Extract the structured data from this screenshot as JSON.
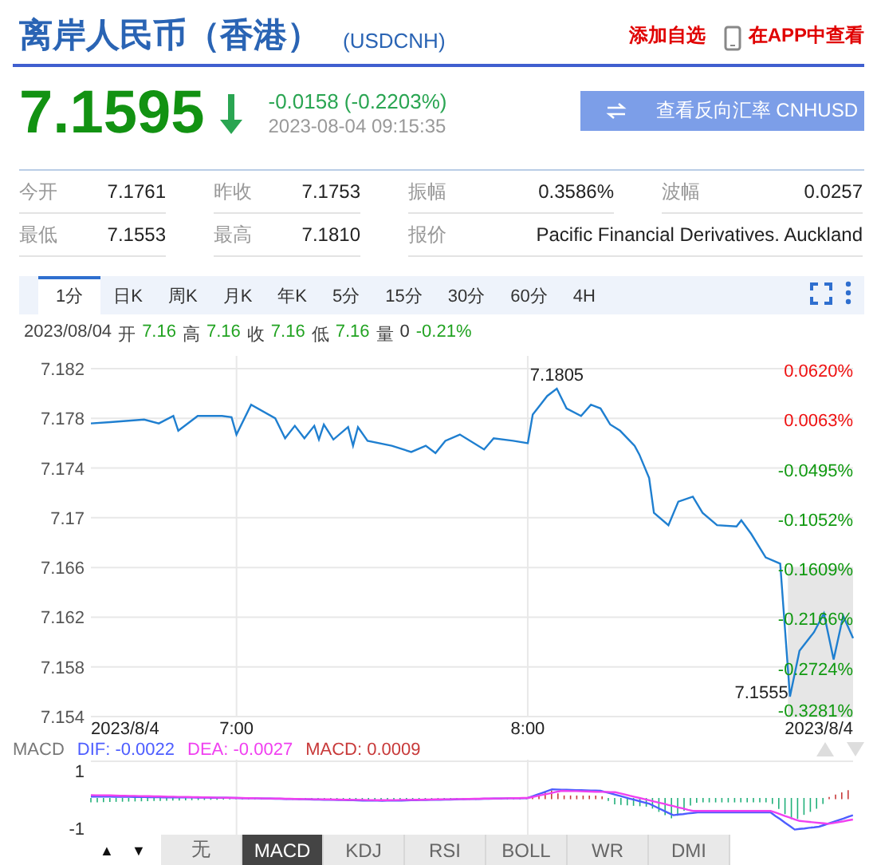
{
  "header": {
    "title": "离岸人民币（香港）",
    "code": "(USDCNH)",
    "watchlist_link": "添加自选",
    "app_link": "在APP中查看"
  },
  "quote": {
    "price": "7.1595",
    "falling": true,
    "change": "-0.0158 (-0.2203%)",
    "time": "2023-08-04 09:15:35",
    "reverse_button": "查看反向汇率 CNHUSD"
  },
  "stats": {
    "rows": [
      [
        {
          "label": "今开",
          "value": "7.1761"
        },
        {
          "label": "昨收",
          "value": "7.1753"
        },
        {
          "label": "振幅",
          "value": "0.3586%"
        },
        {
          "label": "波幅",
          "value": "0.0257"
        }
      ],
      [
        {
          "label": "最低",
          "value": "7.1553"
        },
        {
          "label": "最高",
          "value": "7.1810"
        },
        {
          "label": "报价",
          "value": "Pacific Financial Derivatives. Auckland"
        }
      ]
    ]
  },
  "periods": [
    {
      "label": "1分",
      "selected": true
    },
    {
      "label": "日K",
      "selected": false
    },
    {
      "label": "周K",
      "selected": false
    },
    {
      "label": "月K",
      "selected": false
    },
    {
      "label": "年K",
      "selected": false
    },
    {
      "label": "5分",
      "selected": false
    },
    {
      "label": "15分",
      "selected": false
    },
    {
      "label": "30分",
      "selected": false
    },
    {
      "label": "60分",
      "selected": false
    },
    {
      "label": "4H",
      "selected": false
    }
  ],
  "ohlc": {
    "date": "2023/08/04",
    "fields": [
      {
        "label": "开",
        "value": "7.16",
        "color": "#22a322"
      },
      {
        "label": "高",
        "value": "7.16",
        "color": "#22a322"
      },
      {
        "label": "收",
        "value": "7.16",
        "color": "#22a322"
      },
      {
        "label": "低",
        "value": "7.16",
        "color": "#22a322"
      },
      {
        "label": "量",
        "value": "0",
        "color": "#333333"
      }
    ],
    "change": "-0.21%"
  },
  "chart": {
    "chart_data": {
      "type": "line",
      "x": [
        6.5,
        6.567,
        6.683,
        6.733,
        6.783,
        6.8,
        6.867,
        6.95,
        6.983,
        7,
        7.05,
        7.133,
        7.167,
        7.2,
        7.233,
        7.267,
        7.283,
        7.3,
        7.333,
        7.383,
        7.4,
        7.417,
        7.45,
        7.533,
        7.6,
        7.65,
        7.683,
        7.717,
        7.767,
        7.85,
        7.883,
        7.95,
        8,
        8.017,
        8.067,
        8.1,
        8.133,
        8.183,
        8.217,
        8.25,
        8.283,
        8.317,
        8.367,
        8.383,
        8.417,
        8.433,
        8.483,
        8.517,
        8.567,
        8.6,
        8.65,
        8.717,
        8.733,
        8.767,
        8.817,
        8.867,
        8.9,
        8.933,
        8.983,
        9.017,
        9.05,
        9.083,
        9.117
      ],
      "series": [
        {
          "color": "#1f7fd0",
          "values": [
            7.1776,
            7.1777,
            7.1779,
            7.1776,
            7.1782,
            7.177,
            7.1782,
            7.1782,
            7.1781,
            7.1767,
            7.1791,
            7.178,
            7.1764,
            7.1774,
            7.1764,
            7.1774,
            7.1763,
            7.1775,
            7.1763,
            7.1773,
            7.1758,
            7.1773,
            7.1762,
            7.1758,
            7.1753,
            7.1758,
            7.1752,
            7.1762,
            7.1767,
            7.1755,
            7.1764,
            7.1762,
            7.176,
            7.1783,
            7.1798,
            7.1804,
            7.1788,
            7.1782,
            7.1791,
            7.1788,
            7.1775,
            7.177,
            7.1758,
            7.1751,
            7.1732,
            7.1704,
            7.1694,
            7.1713,
            7.1717,
            7.1704,
            7.1694,
            7.1693,
            7.1698,
            7.1687,
            7.1668,
            7.1663,
            7.1556,
            7.1593,
            7.1608,
            7.1623,
            7.1586,
            7.1621,
            7.1603
          ]
        }
      ],
      "xlim": [
        6.5,
        9.117
      ],
      "ylim": [
        7.154,
        7.182
      ],
      "grid": true,
      "yticks": [
        7.182,
        7.178,
        7.174,
        7.17,
        7.166,
        7.162,
        7.158,
        7.154
      ],
      "xticks": [
        {
          "value": 6.5,
          "label": "2023/8/4"
        },
        {
          "value": 7,
          "label": "7:00"
        },
        {
          "value": 8,
          "label": "8:00"
        },
        {
          "value": 9.117,
          "label": "2023/8/4"
        }
      ],
      "annotations": [
        {
          "x": 8.1,
          "y": 7.1804,
          "text": "7.1805"
        },
        {
          "x": 8.9,
          "y": 7.1556,
          "text": "7.1555"
        }
      ]
    },
    "percent_ticks": [
      {
        "label": "0.0620%",
        "color": "#ee1111"
      },
      {
        "label": "0.0063%",
        "color": "#ee1111"
      },
      {
        "label": "-0.0495%",
        "color": "#119911"
      },
      {
        "label": "-0.1052%",
        "color": "#119911"
      },
      {
        "label": "-0.1609%",
        "color": "#119911"
      },
      {
        "label": "-0.2166%",
        "color": "#119911"
      },
      {
        "label": "-0.2724%",
        "color": "#119911"
      },
      {
        "label": "-0.3281%",
        "color": "#119911"
      }
    ]
  },
  "macd": {
    "label": "MACD",
    "legend": [
      {
        "text": "DIF: -0.0022",
        "color": "#4d5dff"
      },
      {
        "text": "DEA: -0.0027",
        "color": "#f040f0"
      },
      {
        "text": "MACD: 0.0009",
        "color": "#c83a3a"
      }
    ],
    "axis_labels": [
      "1",
      "-1"
    ]
  },
  "indicators": {
    "up": "▲",
    "down": "▼",
    "tabs": [
      {
        "label": "无",
        "selected": false
      },
      {
        "label": "MACD",
        "selected": true
      },
      {
        "label": "KDJ",
        "selected": false
      },
      {
        "label": "RSI",
        "selected": false
      },
      {
        "label": "BOLL",
        "selected": false
      },
      {
        "label": "WR",
        "selected": false
      },
      {
        "label": "DMI",
        "selected": false
      }
    ]
  }
}
